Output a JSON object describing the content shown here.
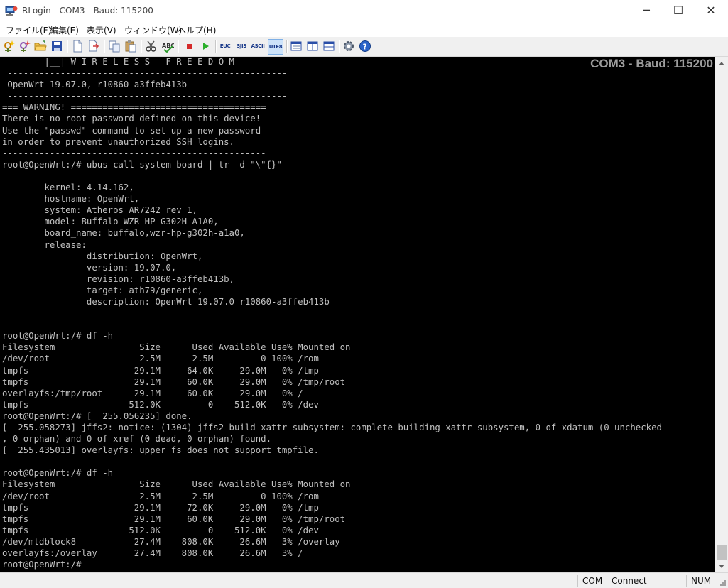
{
  "window": {
    "title": "RLogin - COM3 - Baud: 115200",
    "minimize_glyph": "─",
    "maximize_glyph": "☐",
    "close_glyph": "✕"
  },
  "menu": [
    {
      "label": "ファイル(F)"
    },
    {
      "label": "編集(E)"
    },
    {
      "label": "表示(V)"
    },
    {
      "label": "ウィンドウ(W)"
    },
    {
      "label": "ヘルプ(H)"
    }
  ],
  "toolbar": {
    "icons": [
      "new-connection-icon",
      "connect-icon",
      "open-folder-icon",
      "save-icon",
      "new-document-icon",
      "transfer-icon",
      "copy-icon",
      "paste-icon",
      "scissors-icon",
      "spell-icon",
      "stop-icon",
      "play-icon",
      "euc-icon",
      "sjis-icon",
      "ascii-icon",
      "utf8-icon",
      "layout-tab-icon",
      "layout-split-icon",
      "layout-window-icon",
      "settings-icon",
      "help-icon"
    ],
    "enc_euc": "EUC",
    "enc_sjis": "SJIS",
    "enc_ascii": "ASCII",
    "enc_utf8": "UTF8",
    "accent_color": "#1a3a8a"
  },
  "terminal": {
    "overlay": "COM3 - Baud: 115200",
    "background": "#000000",
    "foreground": "#c0c0c0",
    "lines": [
      "        |__| W I R E L E S S   F R E E D O M",
      " -----------------------------------------------------",
      " OpenWrt 19.07.0, r10860-a3ffeb413b",
      " -----------------------------------------------------",
      "=== WARNING! =====================================",
      "There is no root password defined on this device!",
      "Use the \"passwd\" command to set up a new password",
      "in order to prevent unauthorized SSH logins.",
      "--------------------------------------------------",
      "root@OpenWrt:/# ubus call system board | tr -d \"\\\"{}\"",
      "",
      "        kernel: 4.14.162,",
      "        hostname: OpenWrt,",
      "        system: Atheros AR7242 rev 1,",
      "        model: Buffalo WZR-HP-G302H A1A0,",
      "        board_name: buffalo,wzr-hp-g302h-a1a0,",
      "        release:",
      "                distribution: OpenWrt,",
      "                version: 19.07.0,",
      "                revision: r10860-a3ffeb413b,",
      "                target: ath79/generic,",
      "                description: OpenWrt 19.07.0 r10860-a3ffeb413b",
      "",
      "",
      "root@OpenWrt:/# df -h",
      "Filesystem                Size      Used Available Use% Mounted on",
      "/dev/root                 2.5M      2.5M         0 100% /rom",
      "tmpfs                    29.1M     64.0K     29.0M   0% /tmp",
      "tmpfs                    29.1M     60.0K     29.0M   0% /tmp/root",
      "overlayfs:/tmp/root      29.1M     60.0K     29.0M   0% /",
      "tmpfs                   512.0K         0    512.0K   0% /dev",
      "root@OpenWrt:/# [  255.056235] done.",
      "[  255.058273] jffs2: notice: (1304) jffs2_build_xattr_subsystem: complete building xattr subsystem, 0 of xdatum (0 unchecked",
      ", 0 orphan) and 0 of xref (0 dead, 0 orphan) found.",
      "[  255.435013] overlayfs: upper fs does not support tmpfile.",
      "",
      "root@OpenWrt:/# df -h",
      "Filesystem                Size      Used Available Use% Mounted on",
      "/dev/root                 2.5M      2.5M         0 100% /rom",
      "tmpfs                    29.1M     72.0K     29.0M   0% /tmp",
      "tmpfs                    29.1M     60.0K     29.0M   0% /tmp/root",
      "tmpfs                   512.0K         0    512.0K   0% /dev",
      "/dev/mtdblock8           27.4M    808.0K     26.6M   3% /overlay",
      "overlayfs:/overlay       27.4M    808.0K     26.6M   3% /",
      "root@OpenWrt:/# "
    ]
  },
  "scrollbar": {
    "up_glyph": "▲",
    "down_glyph": "▼"
  },
  "status": {
    "com": "COM",
    "connect": "Connect",
    "num": "NUM"
  }
}
